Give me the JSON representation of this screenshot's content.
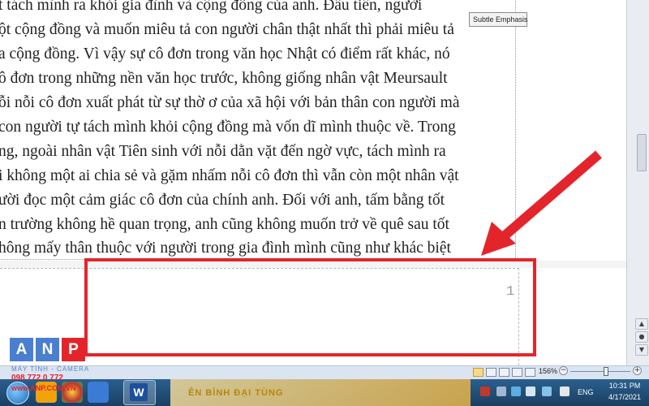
{
  "document": {
    "lines": [
      "t tách mình ra khỏi gia đình và cộng đồng của anh. Đầu tiên, người",
      "ột cộng đồng và muốn miêu tả con người chân thật nhất thì phải miêu tả",
      "a cộng đồng. Vì vậy sự cô đơn trong văn học Nhật có điểm rất khác, nó",
      "ô đơn trong những nền văn học trước, không giống nhân vật Meursault",
      "ỗi nỗi cô đơn xuất phát từ sự thờ ơ của xã hội với bản thân con người  mà",
      "con người tự tách mình khỏi cộng đồng mà vốn dĩ mình thuộc về. Trong",
      "ng, ngoài nhân vật Tiên sinh với nỗi dằn vặt đến ngờ vực, tách mình ra",
      "i không một ai chia sẻ và gặm nhấm nỗi cô đơn thì vẫn còn một nhân vật",
      "ười đọc một cảm giác cô đơn của chính anh. Đối với anh, tấm bằng tốt",
      "n trường không hề quan trọng, anh cũng không muốn trở về quê sau tốt",
      "hông mấy thân thuộc với người trong gia đình mình cũng như khác biệt"
    ],
    "page_number": "1"
  },
  "tooltip": "Subtle Emphasis",
  "status_bar": {
    "zoom_percent": "156%",
    "zoom_minus": "−",
    "zoom_plus": "+",
    "zoom_level_fraction": 0.6
  },
  "taskbar": {
    "banner_text": "ÊN BÌNH ĐẠI TÙNG",
    "word_icon": "W",
    "language": "ENG",
    "time": "10:31 PM",
    "date": "4/17/2021"
  },
  "watermark": {
    "letters": [
      "A",
      "N",
      "P"
    ],
    "subtitle": "MÁY TÍNH - CAMERA",
    "phone": "098 772 0 772",
    "website": "www.ANP.COM.VN"
  },
  "colors": {
    "highlight_red": "#e3252b",
    "logo_blue": "#4a7fd0",
    "logo_red": "#e3252b",
    "statusbar_bg": "#dbe4f1",
    "taskbar_bg": "#1b3f62"
  },
  "icons": {
    "arrow": "red-arrow-icon",
    "start": "windows-start-icon",
    "word": "microsoft-word-icon",
    "volume": "volume-icon",
    "network": "network-icon"
  }
}
